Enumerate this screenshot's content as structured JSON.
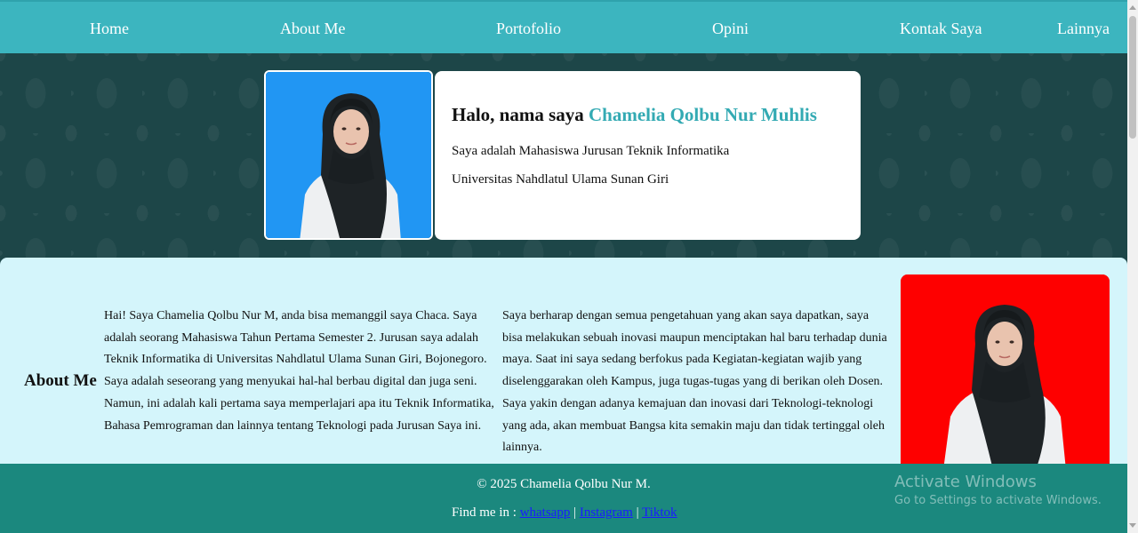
{
  "nav": {
    "items": [
      "Home",
      "About Me",
      "Portofolio",
      "Opini",
      "Kontak Saya",
      "Lainnya"
    ]
  },
  "hero": {
    "greeting": "Halo, nama saya",
    "name": "Chamelia Qolbu Nur Muhlis",
    "line1": "Saya adalah Mahasiswa Jurusan Teknik Informatika",
    "line2": "Universitas Nahdlatul Ulama Sunan Giri",
    "photo_bg": "#2196f3"
  },
  "about": {
    "heading": "About Me",
    "paragraph1": "Hai! Saya Chamelia Qolbu Nur M, anda bisa memanggil saya Chaca. Saya adalah seorang Mahasiswa Tahun Pertama Semester 2. Jurusan saya adalah Teknik Informatika di Universitas Nahdlatul Ulama Sunan Giri, Bojonegoro. Saya adalah seseorang yang menyukai hal-hal berbau digital dan juga seni. Namun, ini adalah kali pertama saya memperlajari apa itu Teknik Informatika, Bahasa Pemrograman dan lainnya tentang Teknologi pada Jurusan Saya ini.",
    "paragraph2": "Saya berharap dengan semua pengetahuan yang akan saya dapatkan, saya bisa melakukan sebuah inovasi maupun menciptakan hal baru terhadap dunia maya. Saat ini saya sedang berfokus pada Kegiatan-kegiatan wajib yang diselenggarakan oleh Kampus, juga tugas-tugas yang di berikan oleh Dosen. Saya yakin dengan adanya kemajuan dan inovasi dari Teknologi-teknologi yang ada, akan membuat Bangsa kita semakin maju dan tidak tertinggal oleh lainnya.",
    "photo_bg": "#fe0000"
  },
  "footer": {
    "copyright": "© 2025 Chamelia Qolbu Nur M.",
    "findme_label": "Find me in :",
    "links": [
      "whatsapp",
      "Instagram",
      "Tiktok"
    ],
    "separator": "|"
  },
  "watermark": {
    "title": "Activate Windows",
    "subtitle": "Go to Settings to activate Windows."
  },
  "colors": {
    "nav_bg": "#3cb5bf",
    "hero_bg": "#1d4648",
    "about_bg": "#d4f5fb",
    "footer_bg": "#1b887e",
    "accent": "#33aab3"
  }
}
